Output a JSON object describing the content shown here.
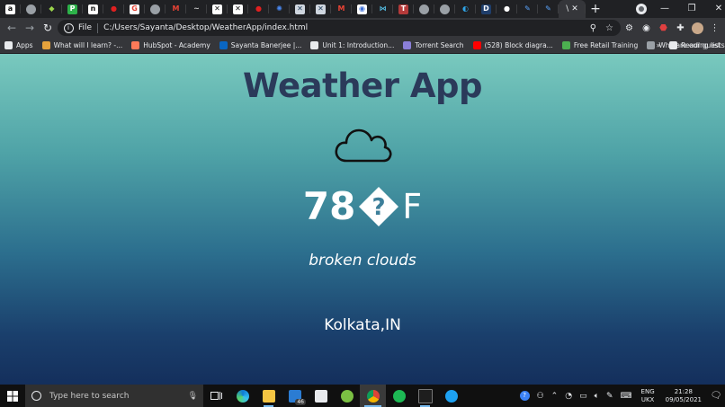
{
  "browser": {
    "tabs": [
      {
        "icon": "amazon-icon",
        "glyph": "a",
        "color": "#ffffff",
        "fg": "#111111"
      },
      {
        "icon": "globe-icon",
        "glyph": "",
        "color": "#9aa0a6",
        "fg": "#202124"
      },
      {
        "icon": "codepen-icon",
        "glyph": "◆",
        "color": "#202124",
        "fg": "#9bd54b"
      },
      {
        "icon": "p-icon",
        "glyph": "P",
        "color": "#2db24a",
        "fg": "#ffffff"
      },
      {
        "icon": "notion-icon",
        "glyph": "n",
        "color": "#ffffff",
        "fg": "#111111"
      },
      {
        "icon": "redhat-icon",
        "glyph": "●",
        "color": "#202124",
        "fg": "#e02020"
      },
      {
        "icon": "google-icon",
        "glyph": "G",
        "color": "#ffffff",
        "fg": "#e34133"
      },
      {
        "icon": "globe-icon",
        "glyph": "",
        "color": "#9aa0a6",
        "fg": "#202124"
      },
      {
        "icon": "gmail-icon",
        "glyph": "M",
        "color": "#202124",
        "fg": "#ea4335"
      },
      {
        "icon": "dash-icon",
        "glyph": "~",
        "color": "#202124",
        "fg": "#cfcfcf"
      },
      {
        "icon": "x-box-icon",
        "glyph": "✕",
        "color": "#ffffff",
        "fg": "#111111"
      },
      {
        "icon": "x-box-icon",
        "glyph": "✕",
        "color": "#ffffff",
        "fg": "#111111"
      },
      {
        "icon": "redhat-icon",
        "glyph": "●",
        "color": "#202124",
        "fg": "#e02020"
      },
      {
        "icon": "gear-icon",
        "glyph": "✺",
        "color": "#202124",
        "fg": "#4a8af4"
      },
      {
        "icon": "x-box-icon",
        "glyph": "✕",
        "color": "#cfd6df",
        "fg": "#23405c"
      },
      {
        "icon": "x-box-icon",
        "glyph": "✕",
        "color": "#cfd6df",
        "fg": "#23405c"
      },
      {
        "icon": "gmail-icon",
        "glyph": "M",
        "color": "#202124",
        "fg": "#ea4335"
      },
      {
        "icon": "blue-circle-icon",
        "glyph": "◉",
        "color": "#ffffff",
        "fg": "#3b6ed8"
      },
      {
        "icon": "bowtie-icon",
        "glyph": "⋈",
        "color": "#202124",
        "fg": "#56c1e8"
      },
      {
        "icon": "tab-box-icon",
        "glyph": "T",
        "color": "#b43a3a",
        "fg": "#ffffff"
      },
      {
        "icon": "globe-icon",
        "glyph": "",
        "color": "#9aa0a6",
        "fg": "#202124"
      },
      {
        "icon": "globe-icon",
        "glyph": "",
        "color": "#9aa0a6",
        "fg": "#202124"
      },
      {
        "icon": "edge-icon",
        "glyph": "◐",
        "color": "#202124",
        "fg": "#2fa4e7"
      },
      {
        "icon": "d-icon",
        "glyph": "D",
        "color": "#1f3e6b",
        "fg": "#ffffff"
      },
      {
        "icon": "github-icon",
        "glyph": "●",
        "color": "#202124",
        "fg": "#ffffff"
      },
      {
        "icon": "pen-icon",
        "glyph": "✎",
        "color": "#202124",
        "fg": "#5aa5ff"
      },
      {
        "icon": "pen-icon",
        "glyph": "✎",
        "color": "#202124",
        "fg": "#5aa5ff"
      }
    ],
    "active_tab": {
      "title": "\\",
      "close": "✕"
    },
    "new_tab_label": "+",
    "window_controls": {
      "minimize": "—",
      "maximize": "❐",
      "close": "✕"
    },
    "address": {
      "scheme": "File",
      "url": "C:/Users/Sayanta/Desktop/WeatherApp/index.html"
    },
    "bookmarks": [
      {
        "label": "Apps",
        "icon": "apps-grid-icon",
        "color": "#e8eaed"
      },
      {
        "label": "What will I learn? -...",
        "icon": "bookmark-colorful-icon",
        "color": "#e6a23c"
      },
      {
        "label": "HubSpot - Academy",
        "icon": "hubspot-icon",
        "color": "#ff7a59"
      },
      {
        "label": "Sayanta Banerjee |...",
        "icon": "linkedin-icon",
        "color": "#0a66c2"
      },
      {
        "label": "Unit 1: Introduction...",
        "icon": "unit-icon",
        "color": "#e8eaed"
      },
      {
        "label": "Torrent Search",
        "icon": "torrent-icon",
        "color": "#8b7fd8"
      },
      {
        "label": "(528) Block diagra...",
        "icon": "youtube-icon",
        "color": "#ff0000"
      },
      {
        "label": "Free Retail Training",
        "icon": "retail-icon",
        "color": "#4caf50"
      },
      {
        "label": "Who are our guests...",
        "icon": "mountain-icon",
        "color": "#9aa0a6"
      }
    ],
    "bookmarks_more": "»",
    "reading_list": "Reading list"
  },
  "weather": {
    "title": "Weather App",
    "temperature": "78",
    "unit": "F",
    "description": "broken clouds",
    "location": "Kolkata,IN"
  },
  "taskbar": {
    "search_placeholder": "Type here to search",
    "mail_badge": "46",
    "language": {
      "line1": "ENG",
      "line2": "UKX"
    },
    "clock": {
      "time": "21:28",
      "date": "09/05/2021"
    }
  }
}
